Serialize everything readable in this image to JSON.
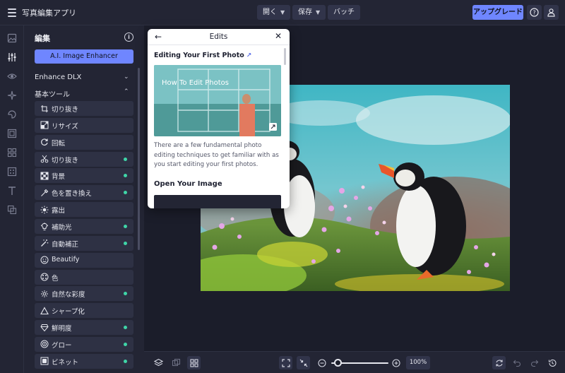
{
  "app": {
    "title": "写真編集アプリ"
  },
  "toolbar": {
    "open_label": "開く",
    "save_label": "保存",
    "batch_label": "バッチ",
    "upgrade_label": "アップグレード"
  },
  "rail": {
    "icons": [
      "image-icon",
      "sliders-icon",
      "eye-icon",
      "sparkle-icon",
      "sticker-icon",
      "frame-icon",
      "collage-icon",
      "texture-icon",
      "text-icon",
      "overlay-icon"
    ],
    "active_index": 1
  },
  "panel": {
    "title": "編集",
    "ai_button": "A.I. Image Enhancer",
    "sections": [
      {
        "label": "Enhance DLX",
        "expanded": false
      },
      {
        "label": "基本ツール",
        "expanded": true
      }
    ],
    "tools": [
      {
        "label": "切り抜き",
        "icon": "crop-icon",
        "premium": false
      },
      {
        "label": "リサイズ",
        "icon": "resize-icon",
        "premium": false
      },
      {
        "label": "回転",
        "icon": "rotate-icon",
        "premium": false
      },
      {
        "label": "切り抜き",
        "icon": "cutout-icon",
        "premium": true
      },
      {
        "label": "背景",
        "icon": "background-icon",
        "premium": true
      },
      {
        "label": "色を置き換え",
        "icon": "eyedropper-icon",
        "premium": true
      },
      {
        "label": "露出",
        "icon": "sun-icon",
        "premium": false
      },
      {
        "label": "補助光",
        "icon": "lightbulb-icon",
        "premium": true
      },
      {
        "label": "自動補正",
        "icon": "magic-wand-icon",
        "premium": true
      },
      {
        "label": "Beautify",
        "icon": "face-icon",
        "premium": false
      },
      {
        "label": "色",
        "icon": "palette-icon",
        "premium": false
      },
      {
        "label": "自然な彩度",
        "icon": "vibrance-icon",
        "premium": true
      },
      {
        "label": "シャープ化",
        "icon": "triangle-icon",
        "premium": false
      },
      {
        "label": "鮮明度",
        "icon": "diamond-icon",
        "premium": true
      },
      {
        "label": "グロー",
        "icon": "glow-icon",
        "premium": true
      },
      {
        "label": "ビネット",
        "icon": "vignette-icon",
        "premium": true
      }
    ]
  },
  "popup": {
    "title": "Edits",
    "link_text": "Editing Your First Photo",
    "thumb_caption": "How To Edit Photos",
    "description": "There are a few fundamental photo editing techniques to get familiar with as you start editing your first photos.",
    "section_heading": "Open Your Image"
  },
  "bottombar": {
    "zoom": "100%",
    "zoom_slider_fraction": 0.12
  },
  "colors": {
    "accent": "#6f86ff",
    "premium_dot": "#3fd6a8",
    "bg": "#1f2130"
  }
}
